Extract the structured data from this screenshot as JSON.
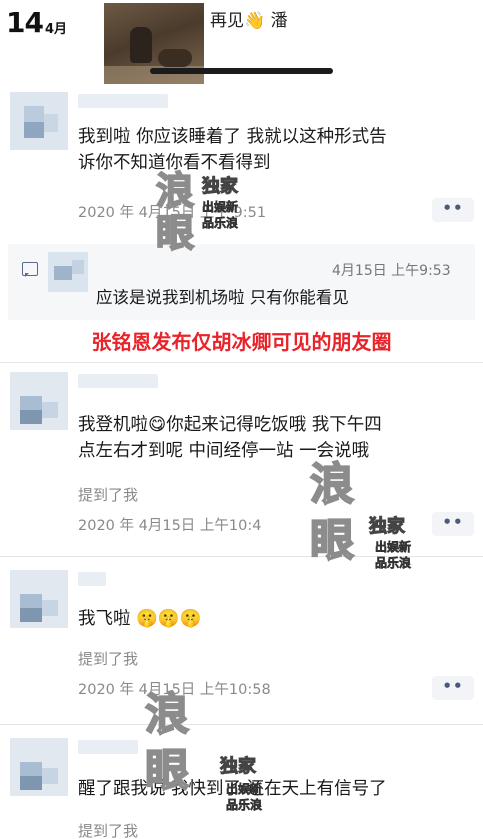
{
  "header": {
    "day": "14",
    "month": "4月",
    "caption": "再见👋 潘"
  },
  "posts": [
    {
      "text": "我到啦 你应该睡着了 我就以这种形式告\n诉你不知道你看不看得到",
      "timestamp": "2020 年 4月15日 上午 9:51",
      "more": "••"
    },
    {
      "text": "我登机啦😋你起来记得吃饭哦 我下午四\n点左右才到呢 中间经停一站 一会说哦",
      "mention": "提到了我",
      "timestamp": "2020 年 4月15日 上午10:4",
      "more": "••"
    },
    {
      "text": "我飞啦 🤫🤫🤫",
      "mention": "提到了我",
      "timestamp": "2020 年 4月15日 上午10:58",
      "more": "••"
    },
    {
      "text": "醒了跟我说 我快到了 还在天上有信号了",
      "mention": "提到了我"
    }
  ],
  "comment": {
    "time": "4月15日 上午9:53",
    "text": "应该是说我到机场啦 只有你能看见"
  },
  "headline": "张铭恩发布仅胡冰卿可见的朋友圈",
  "watermark": {
    "big_char_1": "浪",
    "big_char_2": "眼",
    "stamp_main": "独家",
    "stamp_sub1": "出娱新",
    "stamp_sub2": "品乐浪"
  },
  "colors": {
    "headline": "#e8232a",
    "more_button_bg": "#f2f4f7",
    "comment_bg": "#f6f7f9"
  }
}
